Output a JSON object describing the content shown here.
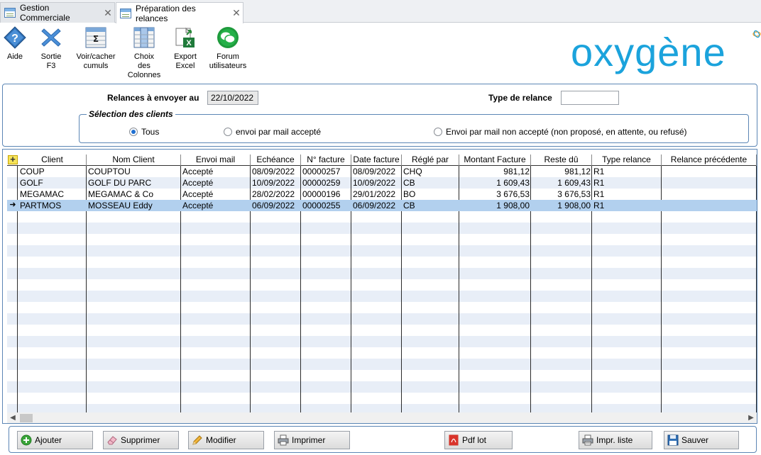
{
  "tabs": [
    {
      "label": "Gestion Commerciale",
      "active": false
    },
    {
      "label": "Préparation des relances",
      "active": true
    }
  ],
  "toolbar": [
    {
      "icon": "help-diamond-icon",
      "label": "Aide"
    },
    {
      "icon": "exit-x-icon",
      "label": "Sortie\nF3"
    },
    {
      "icon": "sigma-sum-icon",
      "label": "Voir/cacher\ncumuls"
    },
    {
      "icon": "columns-icon",
      "label": "Choix\ndes\nColonnes"
    },
    {
      "icon": "excel-export-icon",
      "label": "Export\nExcel"
    },
    {
      "icon": "forum-chat-icon",
      "label": "Forum\nutilisateurs"
    }
  ],
  "logo": {
    "text": "oxygène",
    "color": "#1ba3dc"
  },
  "filters": {
    "date_label": "Relances à envoyer au",
    "date_value": "22/10/2022",
    "type_label": "Type de relance",
    "type_value": "",
    "group_title": "Sélection des clients",
    "options": [
      {
        "label": "Tous",
        "selected": true
      },
      {
        "label": "envoi par mail accepté",
        "selected": false
      },
      {
        "label": "Envoi par mail non accepté (non proposé, en attente, ou refusé)",
        "selected": false
      }
    ]
  },
  "grid": {
    "columns": [
      "Client",
      "Nom Client",
      "Envoi mail",
      "Echéance",
      "N° facture",
      "Date facture",
      "Réglé par",
      "Montant Facture",
      "Reste dû",
      "Type relance",
      "Relance précédente"
    ],
    "rows": [
      [
        "COUP",
        "COUPTOU",
        "Accepté",
        "08/09/2022",
        "00000257",
        "08/09/2022",
        "CHQ",
        "981,12",
        "981,12",
        "R1",
        ""
      ],
      [
        "GOLF",
        "GOLF DU PARC",
        "Accepté",
        "10/09/2022",
        "00000259",
        "10/09/2022",
        "CB",
        "1 609,43",
        "1 609,43",
        "R1",
        ""
      ],
      [
        "MEGAMAC",
        "MEGAMAC & Co",
        "Accepté",
        "28/02/2022",
        "00000196",
        "29/01/2022",
        "BO",
        "3 676,53",
        "3 676,53",
        "R1",
        ""
      ],
      [
        "PARTMOS",
        "MOSSEAU Eddy",
        "Accepté",
        "06/09/2022",
        "00000255",
        "06/09/2022",
        "CB",
        "1 908,00",
        "1 908,00",
        "R1",
        ""
      ]
    ],
    "selected_row": 3,
    "selection_marker": "➜",
    "add_marker": "+",
    "colors": {
      "selected": "#b2d0ee",
      "alt_row": "#e8eef7"
    }
  },
  "buttons": [
    {
      "icon": "add-green-icon",
      "label": "Ajouter"
    },
    {
      "icon": "eraser-icon",
      "label": "Supprimer"
    },
    {
      "icon": "pencil-icon",
      "label": "Modifier"
    },
    {
      "icon": "printer-icon",
      "label": "Imprimer"
    },
    {
      "icon": "pdf-icon",
      "label": "Pdf lot"
    },
    {
      "icon": "print-list-icon",
      "label": "Impr. liste"
    },
    {
      "icon": "save-disk-icon",
      "label": "Sauver"
    }
  ]
}
